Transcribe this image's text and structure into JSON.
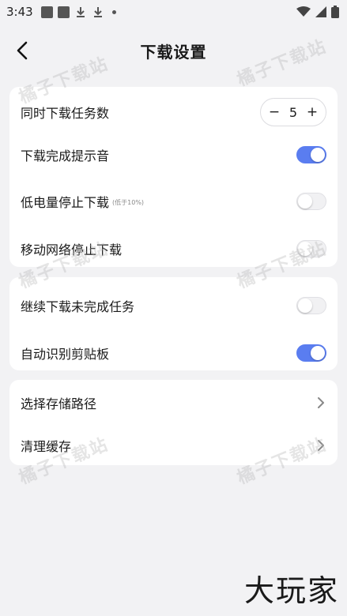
{
  "status_bar": {
    "time": "3:43"
  },
  "header": {
    "title": "下载设置"
  },
  "group1": {
    "concurrent": {
      "label": "同时下载任务数",
      "value": "5",
      "minus": "−",
      "plus": "+"
    },
    "complete_sound": {
      "label": "下载完成提示音",
      "on": true
    },
    "low_battery": {
      "label": "低电量停止下载",
      "note": "(低于10%)",
      "on": false
    },
    "mobile_network": {
      "label": "移动网络停止下载",
      "on": false
    }
  },
  "group2": {
    "resume": {
      "label": "继续下载未完成任务",
      "on": false
    },
    "clipboard": {
      "label": "自动识别剪贴板",
      "on": true
    }
  },
  "group3": {
    "storage_path": {
      "label": "选择存储路径"
    },
    "clear_cache": {
      "label": "清理缓存"
    }
  },
  "watermark": "橘子下载站",
  "brand_logo": "大玩家",
  "colors": {
    "accent": "#5a7df0",
    "background": "#f2f2f4",
    "card": "#ffffff"
  }
}
